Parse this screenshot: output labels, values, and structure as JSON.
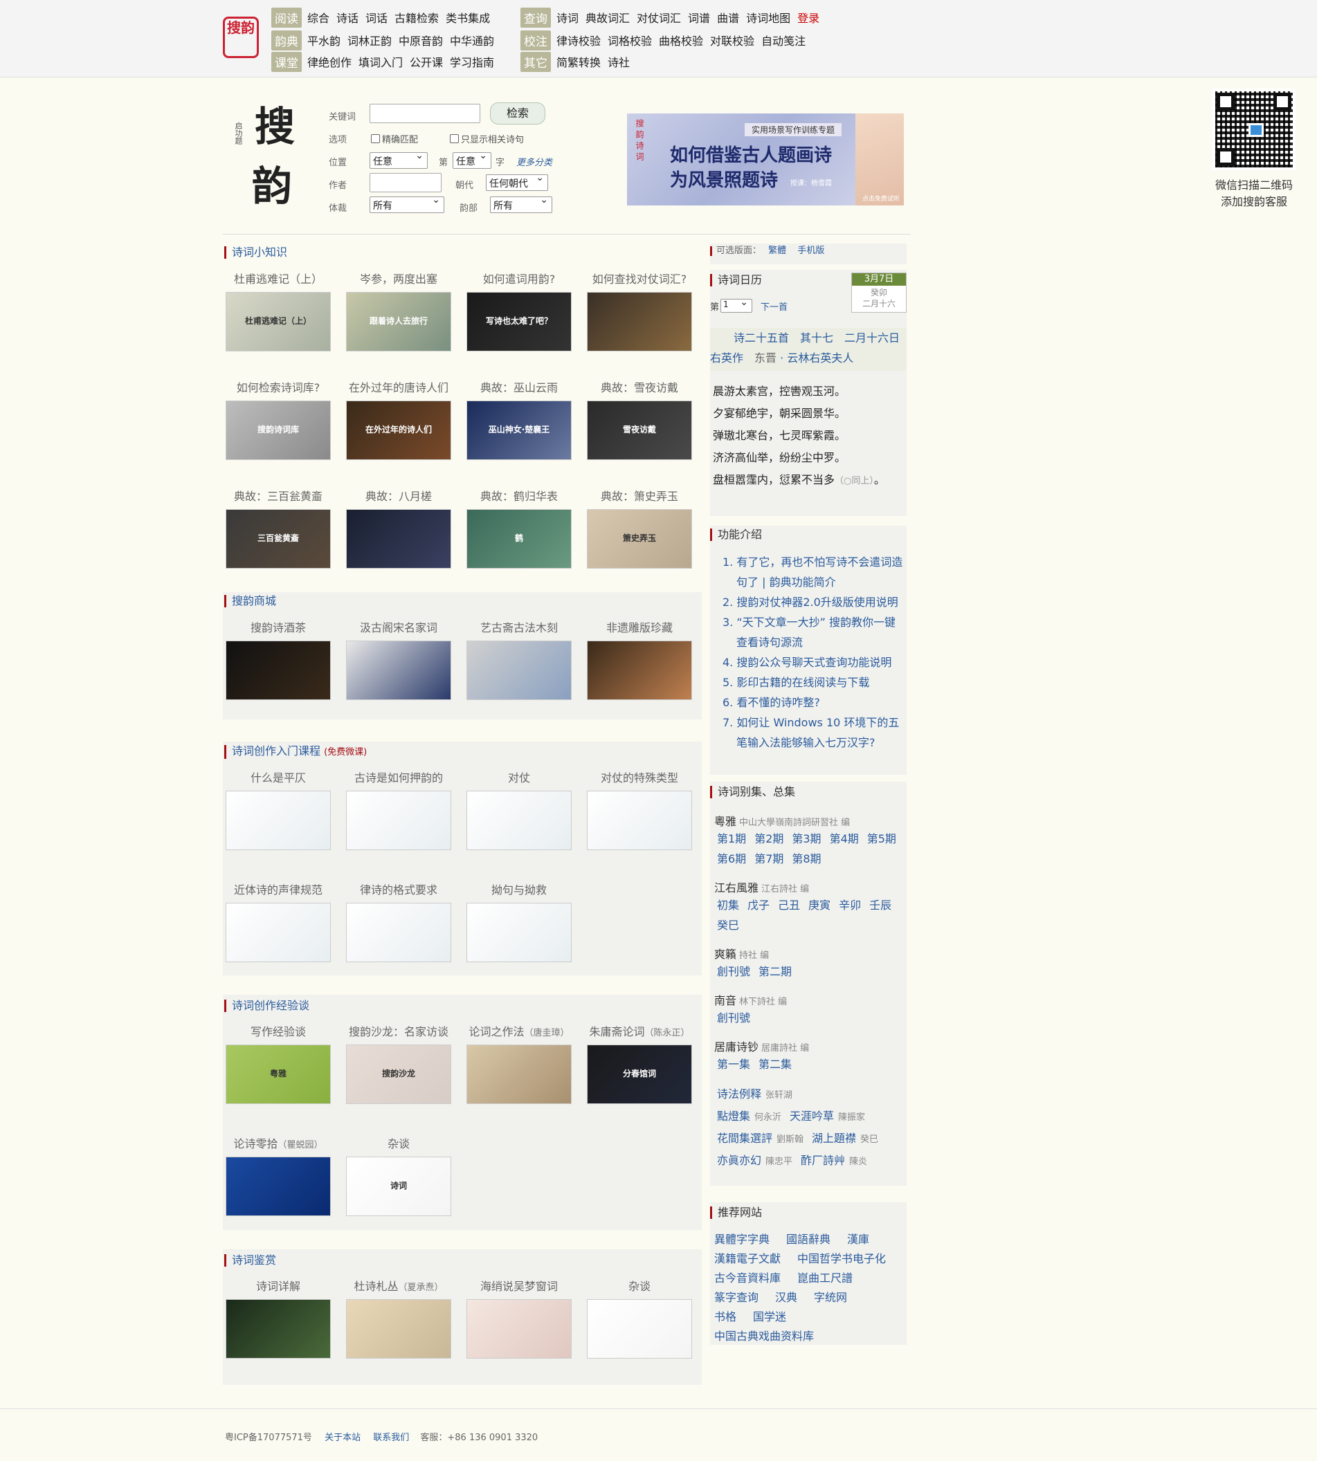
{
  "logo": {
    "text": "搜韵"
  },
  "nav": [
    {
      "tag": "阅读",
      "links": [
        "综合",
        "诗话",
        "词话",
        "古籍检索",
        "类书集成"
      ]
    },
    {
      "tag": "查询",
      "links": [
        "诗词",
        "典故词汇",
        "对仗词汇",
        "词谱",
        "曲谱",
        "诗词地图"
      ],
      "login": "登录"
    },
    {
      "tag": "韵典",
      "links": [
        "平水韵",
        "词林正韵",
        "中原音韵",
        "中华通韵"
      ]
    },
    {
      "tag": "校注",
      "links": [
        "律诗校验",
        "词格校验",
        "曲格校验",
        "对联校验",
        "自动笺注"
      ]
    },
    {
      "tag": "课堂",
      "links": [
        "律绝创作",
        "填词入门",
        "公开课",
        "学习指南"
      ]
    },
    {
      "tag": "其它",
      "links": [
        "简繁转换",
        "诗社"
      ]
    }
  ],
  "brand": {
    "char1": "搜",
    "char2": "韵",
    "sig": "启功题"
  },
  "search": {
    "keyword_label": "关键词",
    "button": "检索",
    "options_label": "选项",
    "exact": "精确匹配",
    "only_related": "只显示相关诗句",
    "position_label": "位置",
    "position_value": "任意",
    "nth_label": "第",
    "nth_value": "任意",
    "char_label": "字",
    "more": "更多分类",
    "author_label": "作者",
    "dynasty_label": "朝代",
    "dynasty_value": "任何朝代",
    "genre_label": "体裁",
    "genre_value": "所有",
    "rhyme_label": "韵部",
    "rhyme_value": "所有"
  },
  "banner": {
    "vtext": "搜韵诗词",
    "sub": "实用场景写作训练专题",
    "line1": "如何借鉴古人题画诗",
    "line2": "为风景照题诗",
    "teacher": "授课：杨雪霞",
    "note": "点击免费试听"
  },
  "qr": {
    "caption1": "微信扫描二维码",
    "caption2": "添加搜韵客服"
  },
  "sections": {
    "knowledge": {
      "title": "诗词小知识",
      "items": [
        {
          "cap": "杜甫逃难记（上）",
          "thumb": "杜甫逃难记（上）"
        },
        {
          "cap": "岑参，两度出塞",
          "thumb": "跟着诗人去旅行"
        },
        {
          "cap": "如何遣词用韵?",
          "thumb": "写诗也太难了吧？"
        },
        {
          "cap": "如何查找对仗词汇?",
          "thumb": ""
        },
        {
          "cap": "如何检索诗词库?",
          "thumb": "搜韵诗词库"
        },
        {
          "cap": "在外过年的唐诗人们",
          "thumb": "在外过年的诗人们"
        },
        {
          "cap": "典故：巫山云雨",
          "thumb": "巫山神女·楚襄王"
        },
        {
          "cap": "典故：雪夜访戴",
          "thumb": "雪夜访戴"
        },
        {
          "cap": "典故：三百瓮黄齑",
          "thumb": "三百瓮黄齑"
        },
        {
          "cap": "典故：八月槎",
          "thumb": ""
        },
        {
          "cap": "典故：鹤归华表",
          "thumb": "鹤"
        },
        {
          "cap": "典故：箫史弄玉",
          "thumb": "箫史弄玉"
        }
      ]
    },
    "shop": {
      "title": "搜韵商城",
      "items": [
        {
          "cap": "搜韵诗酒茶"
        },
        {
          "cap": "汲古阁宋名家词"
        },
        {
          "cap": "艺古斋古法木刻"
        },
        {
          "cap": "非遗雕版珍藏"
        }
      ]
    },
    "course": {
      "title": "诗词创作入门课程",
      "title_note": "(免费微课)",
      "items": [
        {
          "cap": "什么是平仄"
        },
        {
          "cap": "古诗是如何押韵的"
        },
        {
          "cap": "对仗"
        },
        {
          "cap": "对仗的特殊类型"
        },
        {
          "cap": "近体诗的声律规范"
        },
        {
          "cap": "律诗的格式要求"
        },
        {
          "cap": "拗句与拗救"
        }
      ]
    },
    "experience": {
      "title": "诗词创作经验谈",
      "items": [
        {
          "cap": "写作经验谈",
          "note": "",
          "thumb": "粤雅"
        },
        {
          "cap": "搜韵沙龙：名家访谈",
          "note": "",
          "thumb": "搜韵沙龙"
        },
        {
          "cap": "论词之作法",
          "note": "（唐圭璋）",
          "thumb": ""
        },
        {
          "cap": "朱庸斋论词",
          "note": "（陈永正）",
          "thumb": "分春馆词"
        },
        {
          "cap": "论诗零拾",
          "note": "（瞿蜕园）",
          "thumb": ""
        },
        {
          "cap": "杂谈",
          "note": "",
          "thumb": "诗词"
        }
      ]
    },
    "appreciation": {
      "title": "诗词鉴赏",
      "items": [
        {
          "cap": "诗词详解",
          "note": ""
        },
        {
          "cap": "杜诗札丛",
          "note": "（夏承焘）"
        },
        {
          "cap": "海绡说吴梦窗词",
          "note": ""
        },
        {
          "cap": "杂谈",
          "note": ""
        }
      ]
    }
  },
  "right": {
    "version_label": "可选版面：",
    "version_links": [
      "繁體",
      "手机版"
    ],
    "calendar_title": "诗词日历",
    "cal_date": "3月7日",
    "cal_ganzhi": "癸卯",
    "cal_lunar": "二月十六",
    "nav_prefix": "第",
    "nav_select": "1",
    "nav_next": "下一首",
    "poem_title": "诗二十五首　其十七　二月十六日右英作",
    "poem_dynasty": "东晋",
    "poem_author": "云林右英夫人",
    "poem_lines": [
      "晨游太素宫，控轡观玉河。",
      "夕宴郁绝宇，朝采圆景华。",
      "弹璈北寒台，七灵晖紫霞。",
      "济济高仙举，纷纷尘中罗。",
      "盘桓嚣䨟内，愆累不当多"
    ],
    "poem_note": "（○同上）",
    "poem_end": "。",
    "func_title": "功能介绍",
    "func_items": [
      "有了它，再也不怕写诗不会遣词造句了 | 韵典功能简介",
      "搜韵对仗神器2.0升级版使用说明",
      "“天下文章一大抄” 搜韵教你一键查看诗句源流",
      "搜韵公众号聊天式查询功能说明",
      "影印古籍的在线阅读与下载",
      "看不懂的诗咋整?",
      "如何让 Windows 10 环境下的五笔输入法能够输入七万汉字?"
    ],
    "coll_title": "诗词别集、总集",
    "collections": [
      {
        "name": "粵雅",
        "editor": "中山大學嶺南詩詞研習社 编",
        "links": [
          "第1期",
          "第2期",
          "第3期",
          "第4期",
          "第5期",
          "第6期",
          "第7期",
          "第8期"
        ]
      },
      {
        "name": "江右風雅",
        "editor": "江右詩社 编",
        "links": [
          "初集",
          "戊子",
          "己丑",
          "庚寅",
          "辛卯",
          "壬辰",
          "癸巳"
        ]
      },
      {
        "name": "爽籟",
        "editor": "持社 编",
        "links": [
          "創刊號",
          "第二期"
        ]
      },
      {
        "name": "南音",
        "editor": "林下詩社 编",
        "links": [
          "創刊號"
        ]
      },
      {
        "name": "居庸诗钞",
        "editor": "居庸詩社 编",
        "links": [
          "第一集",
          "第二集"
        ]
      }
    ],
    "extra_colls": [
      [
        {
          "t": "诗法例释",
          "a": "张轩湖"
        }
      ],
      [
        {
          "t": "點燈集",
          "a": "何永沂"
        },
        {
          "t": "天涯吟草",
          "a": "陳振家"
        }
      ],
      [
        {
          "t": "花間集選評",
          "a": "劉斯翰"
        },
        {
          "t": "湖上題襟",
          "a": "癸巳"
        }
      ],
      [
        {
          "t": "亦眞亦幻",
          "a": "陳忠平"
        },
        {
          "t": "酢厂詩艸",
          "a": "陳炎"
        }
      ]
    ],
    "rec_title": "推荐网站",
    "rec_rows": [
      [
        "異體字字典",
        "國語辭典",
        "漢庫"
      ],
      [
        "漢籍電子文獻",
        "中国哲学书电子化"
      ],
      [
        "古今音資料庫",
        "崑曲工尺譜"
      ],
      [
        "篆字查询",
        "汉典",
        "字统网"
      ],
      [
        "书格",
        "国学迷"
      ],
      [
        "中国古典戏曲资料库"
      ]
    ]
  },
  "footer": {
    "icp": "粤ICP备17077571号",
    "about": "关于本站",
    "contact": "联系我们",
    "service": "客服：+86 136 0901 3320"
  }
}
